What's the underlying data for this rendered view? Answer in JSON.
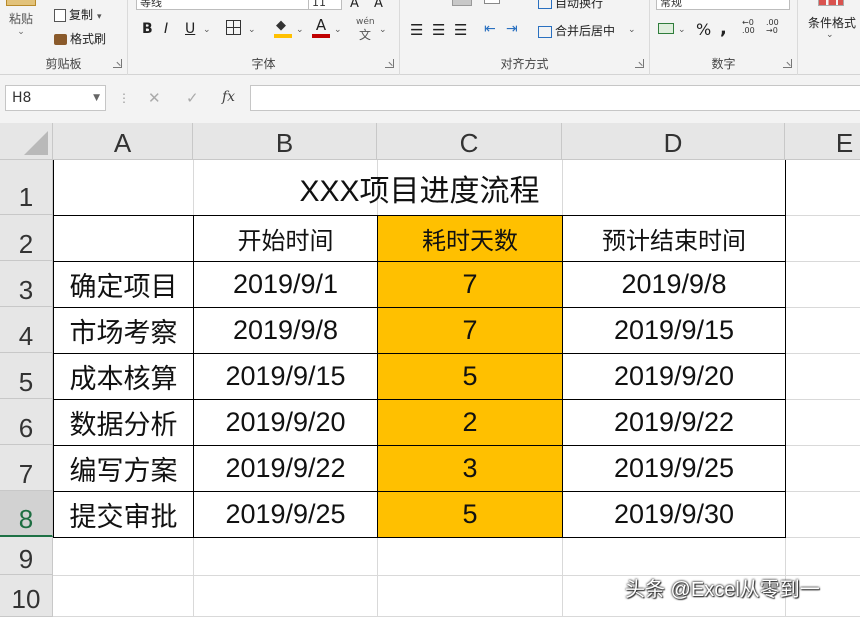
{
  "ribbon": {
    "clipboard": {
      "paste_label": "粘贴",
      "copy_label": "复制",
      "format_painter_label": "格式刷",
      "group_label": "剪贴板"
    },
    "font": {
      "font_name": "等线",
      "font_size": "11",
      "bold": "B",
      "italic": "I",
      "underline": "U",
      "phonetic": "wén",
      "group_label": "字体",
      "font_color": "#c00000",
      "fill_color": "#ffc000"
    },
    "alignment": {
      "wrap_text_label": "自动换行",
      "merge_center_label": "合并后居中",
      "group_label": "对齐方式"
    },
    "number": {
      "format_value": "常规",
      "percent": "%",
      "comma": ",",
      "group_label": "数字"
    },
    "styles": {
      "conditional_format_label": "条件格式"
    }
  },
  "formula_bar": {
    "name_box": "H8",
    "fx": "fx",
    "formula": ""
  },
  "grid": {
    "columns": [
      "A",
      "B",
      "C",
      "D",
      "E"
    ],
    "rows": [
      "1",
      "2",
      "3",
      "4",
      "5",
      "6",
      "7",
      "8",
      "9",
      "10"
    ],
    "active_row": "8",
    "highlight_color": "#ffc000"
  },
  "table": {
    "title": "XXX项目进度流程",
    "headers": [
      "",
      "开始时间",
      "耗时天数",
      "预计结束时间"
    ],
    "rows": [
      {
        "task": "确定项目",
        "start": "2019/9/1",
        "days": "7",
        "end": "2019/9/8"
      },
      {
        "task": "市场考察",
        "start": "2019/9/8",
        "days": "7",
        "end": "2019/9/15"
      },
      {
        "task": "成本核算",
        "start": "2019/9/15",
        "days": "5",
        "end": "2019/9/20"
      },
      {
        "task": "数据分析",
        "start": "2019/9/20",
        "days": "2",
        "end": "2019/9/22"
      },
      {
        "task": "编写方案",
        "start": "2019/9/22",
        "days": "3",
        "end": "2019/9/25"
      },
      {
        "task": "提交审批",
        "start": "2019/9/25",
        "days": "5",
        "end": "2019/9/30"
      }
    ]
  },
  "watermark": "头条 @Excel从零到一"
}
